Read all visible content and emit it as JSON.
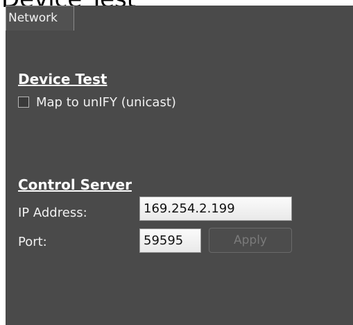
{
  "window": {
    "title": "Device Test"
  },
  "tabs": [
    {
      "label": "Network"
    }
  ],
  "device_test": {
    "title": "Device Test",
    "checkbox_label": "Map to unIFY  (unicast)",
    "checked": false
  },
  "control_server": {
    "title": "Control Server",
    "ip_label": "IP Address:",
    "ip_value": "169.254.2.199",
    "port_label": "Port:",
    "port_value": "59595",
    "apply_label": "Apply"
  }
}
